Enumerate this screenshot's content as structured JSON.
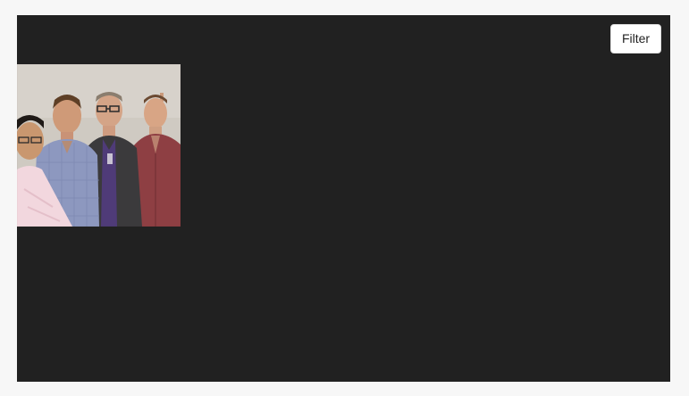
{
  "toolbar": {
    "filter_label": "Filter"
  },
  "gallery": {
    "photo": {
      "icon": "group-photo-thumbnail"
    }
  },
  "colors": {
    "panel_background": "#212121",
    "page_background": "#f7f7f7",
    "button_background": "#ffffff"
  }
}
